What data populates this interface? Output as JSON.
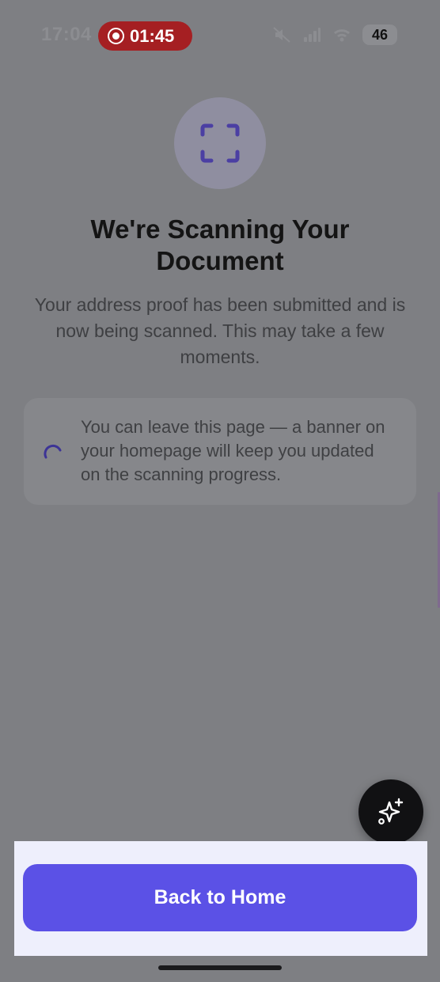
{
  "status_bar": {
    "time": "17:04",
    "recording_time": "01:45",
    "battery_level": "46",
    "icons": [
      "mute-icon",
      "signal-icon",
      "wifi-icon",
      "battery-icon"
    ]
  },
  "scan_icon": "scan-frame-icon",
  "title": "We're Scanning Your Document",
  "subtitle": "Your address proof has been submitted and is now being scanned. This may take a few moments.",
  "info_card": {
    "icon": "loading-spinner-icon",
    "text": "You can leave this page — a banner on your homepage will keep you updated on the scanning progress."
  },
  "fab_icon": "sparkles-icon",
  "back_button_label": "Back to Home",
  "colors": {
    "accent": "#5b51e6",
    "scan_icon": "#4b3fa3",
    "overlay": "#7e7f83"
  }
}
